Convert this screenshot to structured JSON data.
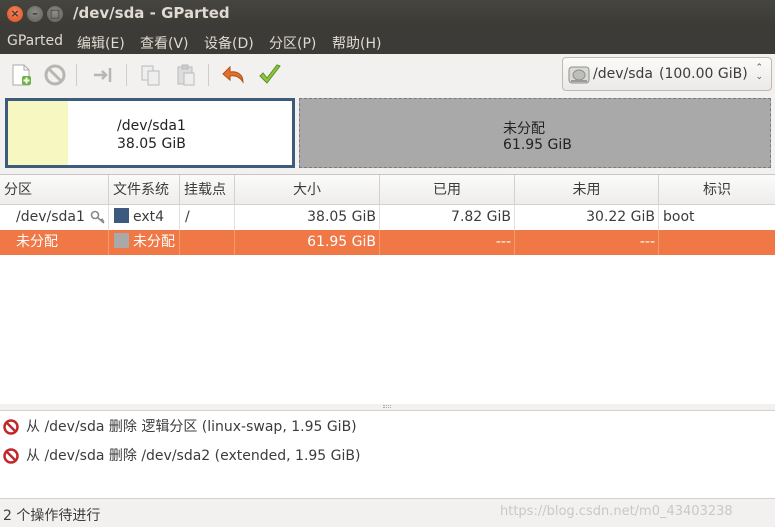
{
  "window": {
    "title": "/dev/sda - GParted",
    "close": "×",
    "minimize": "–",
    "maximize": "□"
  },
  "menu": [
    "GParted",
    "编辑(E)",
    "查看(V)",
    "设备(D)",
    "分区(P)",
    "帮助(H)"
  ],
  "toolbar": {
    "icons": [
      "new-partition-icon",
      "delete-icon",
      "resize-move-icon",
      "copy-icon",
      "paste-icon",
      "undo-icon",
      "apply-icon"
    ]
  },
  "device": {
    "name": "/dev/sda",
    "size": "(100.00 GiB)",
    "arrows": "⌃\n⌄"
  },
  "disk_map": {
    "sda1": {
      "name": "/dev/sda1",
      "size": "38.05 GiB",
      "used_fraction": 0.21
    },
    "unallocated": {
      "name": "未分配",
      "size": "61.95 GiB"
    }
  },
  "table": {
    "headers": [
      "分区",
      "文件系统",
      "挂载点",
      "大小",
      "已用",
      "未用",
      "标识"
    ],
    "rows": [
      {
        "partition": "/dev/sda1",
        "has_key_icon": true,
        "fs": "ext4",
        "fs_color": "#3b5a7d",
        "mount": "/",
        "size": "38.05 GiB",
        "used": "7.82 GiB",
        "unused": "30.22 GiB",
        "flags": "boot",
        "selected": false
      },
      {
        "partition": "未分配",
        "has_key_icon": false,
        "fs": "未分配",
        "fs_color": "#a9a9a9",
        "mount": "",
        "size": "61.95 GiB",
        "used": "---",
        "unused": "---",
        "flags": "",
        "selected": true
      }
    ]
  },
  "operations": [
    {
      "icon": "delete-op-icon",
      "text": "从 /dev/sda 删除 逻辑分区 (linux-swap, 1.95 GiB)"
    },
    {
      "icon": "delete-op-icon",
      "text": "从 /dev/sda 删除 /dev/sda2 (extended, 1.95 GiB)"
    }
  ],
  "status": {
    "text": "2 个操作待进行",
    "watermark": "https://blog.csdn.net/m0_43403238"
  },
  "colors": {
    "selected_row": "#f07746",
    "sda1_border": "#3d5b7a",
    "used_space": "#f7f7c2",
    "unallocated": "#a9a9a9"
  }
}
